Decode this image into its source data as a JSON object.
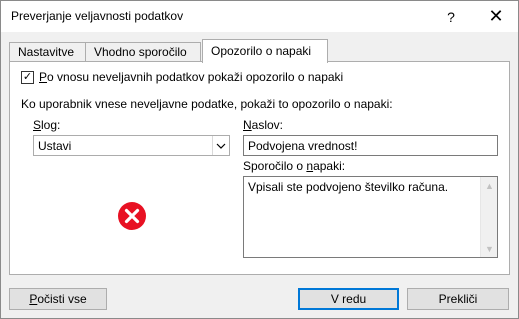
{
  "window": {
    "title": "Preverjanje veljavnosti podatkov",
    "help_glyph": "?",
    "close_glyph": "✕"
  },
  "tabs": [
    {
      "label": "Nastavitve",
      "active": false
    },
    {
      "label": "Vhodno sporočilo",
      "active": false
    },
    {
      "label": "Opozorilo o napaki",
      "active": true
    }
  ],
  "checkbox": {
    "checked": true,
    "mark": "✓",
    "label_key": "P",
    "label_rest": "o vnosu neveljavnih podatkov pokaži opozorilo o napaki"
  },
  "section_label": "Ko uporabnik vnese neveljavne podatke, pokaži to opozorilo o napaki:",
  "style_field": {
    "label_key": "S",
    "label_rest": "log:",
    "value": "Ustavi",
    "arrow_glyph": "⌵"
  },
  "title_field": {
    "label_key": "N",
    "label_rest": "aslov:",
    "value": "Podvojena vrednost!"
  },
  "message_field": {
    "label_pre": "Sporočilo o ",
    "label_key": "n",
    "label_rest": "apaki:",
    "value": "Vpisali ste podvojeno številko računa."
  },
  "buttons": {
    "clear_key": "P",
    "clear_rest": "očisti vse",
    "ok": "V redu",
    "cancel": "Prekliči"
  },
  "colors": {
    "error_icon": "#e81123",
    "default_button_border": "#0078d7"
  },
  "icons": {
    "error": "error-stop-icon"
  }
}
